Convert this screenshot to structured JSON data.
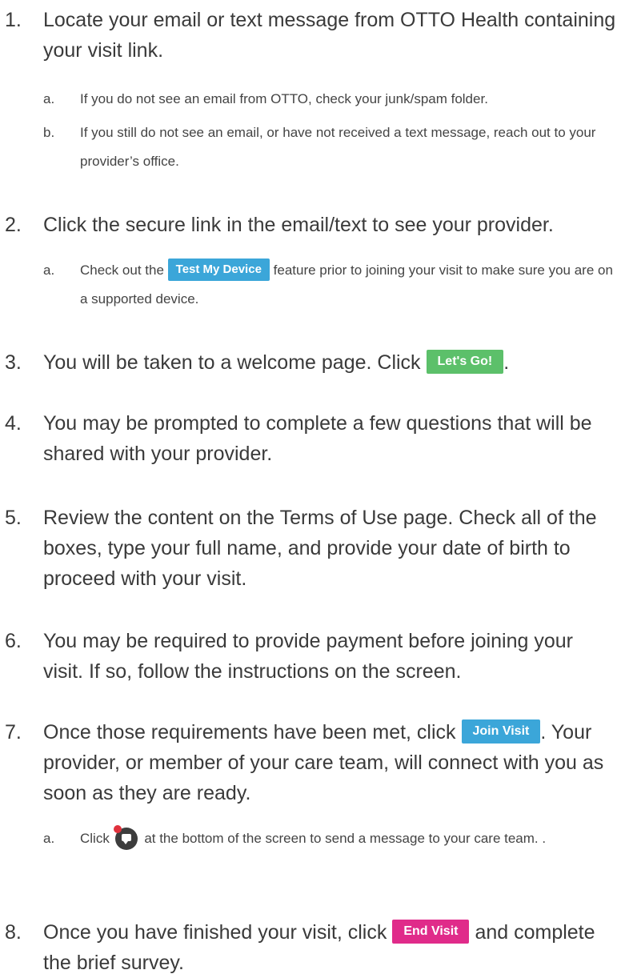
{
  "colors": {
    "blue_button": "#3ba6d9",
    "green_button": "#5cc06a",
    "pink_button": "#e02b8a",
    "chat_notification": "#e0313c"
  },
  "steps": [
    {
      "num": "1.",
      "text": "Locate your email or text message from OTTO Health containing your visit link.",
      "subs": [
        {
          "num": "a.",
          "text": "If you do not see an email from OTTO, check your junk/spam folder."
        },
        {
          "num": "b.",
          "text": "If you still do not see an email, or have not received a text message, reach out to your provider’s office."
        }
      ]
    },
    {
      "num": "2.",
      "text": "Click the secure link in the email/text to see your provider.",
      "subs": [
        {
          "num": "a.",
          "before": "Check out the",
          "button": "Test My Device",
          "after": "feature prior to joining your visit to make sure you are on a supported device."
        }
      ]
    },
    {
      "num": "3.",
      "before": "You will be taken to a welcome page. Click",
      "button": "Let's Go!",
      "after": "."
    },
    {
      "num": "4.",
      "text": "You may be prompted to complete a few questions that will be shared with your provider."
    },
    {
      "num": "5.",
      "text": "Review the content on the Terms of Use page. Check all of the boxes, type your full name, and provide your date of birth to proceed with your visit."
    },
    {
      "num": "6.",
      "text": "You may be required to provide payment before joining your visit. If so, follow the instructions on the screen."
    },
    {
      "num": "7.",
      "before": "Once those requirements have been met, click",
      "button": "Join Visit",
      "after": ". Your provider, or member of your care team, will connect with you as soon as they are ready.",
      "subs": [
        {
          "num": "a.",
          "before": "Click",
          "after": "at the bottom of the screen to send a message to your care team. ."
        }
      ]
    },
    {
      "num": "8.",
      "before": "Once you have finished your visit, click",
      "button": "End Visit",
      "after": "and complete the brief survey."
    }
  ]
}
